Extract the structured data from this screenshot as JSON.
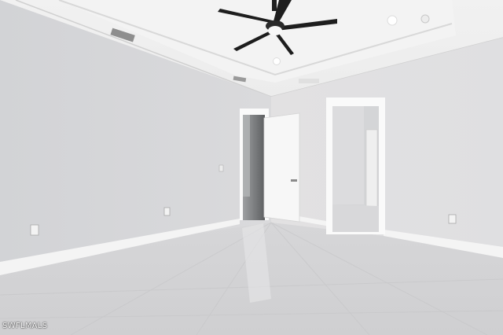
{
  "watermark": "SWFLMALS"
}
